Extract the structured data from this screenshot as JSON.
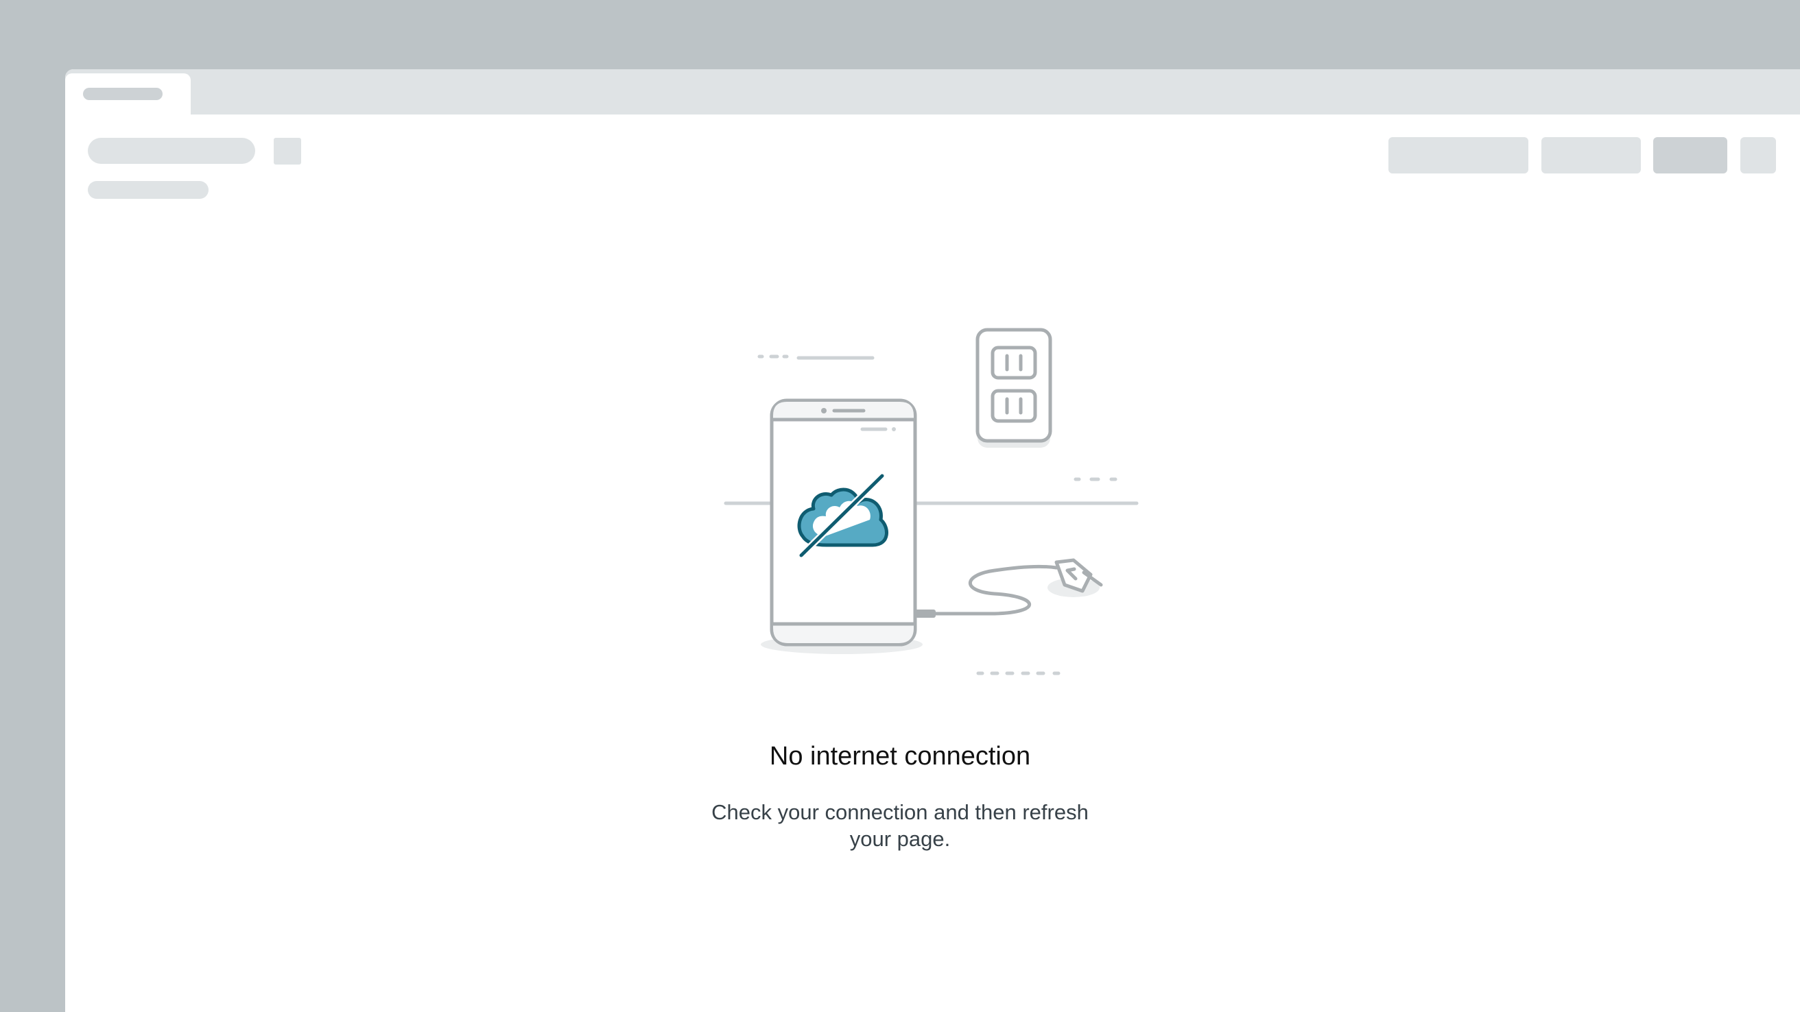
{
  "empty_state": {
    "title": "No internet connection",
    "message": "Check your connection and then refresh your page."
  },
  "illustration": {
    "icons": [
      "smartphone-icon",
      "cloud-offline-icon",
      "wall-outlet-icon",
      "unplugged-cable-icon"
    ],
    "accent_color": "#0f5c70",
    "accent_fill": "#56aac4",
    "line_color": "#a9aeb1"
  },
  "colors": {
    "backdrop": "#bcc3c6",
    "placeholder": "#dfe3e5",
    "placeholder_dark": "#cdd2d5",
    "title_text": "#111111",
    "body_text": "#374148"
  }
}
